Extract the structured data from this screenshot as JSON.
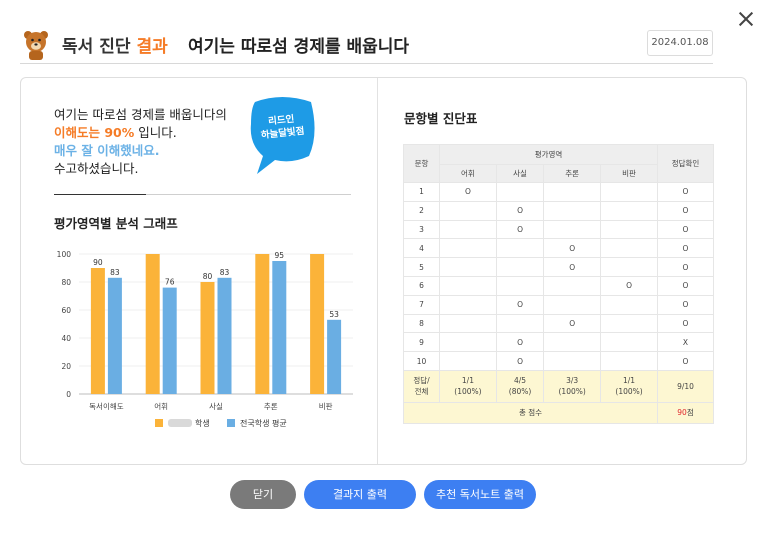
{
  "header": {
    "title": "독서 진단",
    "title_accent": "결과",
    "book_title": "여기는 따로섬 경제를 배웁니다",
    "date": "2024.01.08"
  },
  "message": {
    "line1": "여기는 따로섬 경제를 배웁니다의",
    "line2_highlight": "이해도는 90%",
    "line2_rest": " 입니다.",
    "line3": "매우 잘 이해했네요.",
    "line4": "수고하셨습니다."
  },
  "badge": {
    "line1": "리드인",
    "line2": "하늘달빛점"
  },
  "chart_section_title": "평가영역별 분석 그래프",
  "chart_data": {
    "type": "bar",
    "categories": [
      "독서이해도",
      "어휘",
      "사실",
      "추론",
      "비판"
    ],
    "series": [
      {
        "name": "학생",
        "values": [
          90,
          100,
          80,
          100,
          100
        ],
        "labels": [
          "90",
          "",
          "80",
          "",
          ""
        ],
        "color": "#fbb339"
      },
      {
        "name": "전국학생 평균",
        "values": [
          83,
          76,
          83,
          95,
          53
        ],
        "labels": [
          "83",
          "76",
          "83",
          "95",
          "53"
        ],
        "color": "#6aaee3"
      }
    ],
    "ylim": [
      0,
      100
    ],
    "yticks": [
      "0",
      "20",
      "40",
      "60",
      "80",
      "100"
    ],
    "legend_position": "bottom"
  },
  "table_section_title": "문항별 진단표",
  "table": {
    "col_question": "문항",
    "col_group": "평가영역",
    "col_check": "정답확인",
    "areas": [
      "어휘",
      "사실",
      "추론",
      "비판"
    ],
    "rows": [
      {
        "no": "1",
        "cells": [
          "O",
          "",
          "",
          ""
        ],
        "check": "O"
      },
      {
        "no": "2",
        "cells": [
          "",
          "O",
          "",
          ""
        ],
        "check": "O"
      },
      {
        "no": "3",
        "cells": [
          "",
          "O",
          "",
          ""
        ],
        "check": "O"
      },
      {
        "no": "4",
        "cells": [
          "",
          "",
          "O",
          ""
        ],
        "check": "O"
      },
      {
        "no": "5",
        "cells": [
          "",
          "",
          "O",
          ""
        ],
        "check": "O"
      },
      {
        "no": "6",
        "cells": [
          "",
          "",
          "",
          "O"
        ],
        "check": "O"
      },
      {
        "no": "7",
        "cells": [
          "",
          "O",
          "",
          ""
        ],
        "check": "O"
      },
      {
        "no": "8",
        "cells": [
          "",
          "",
          "O",
          ""
        ],
        "check": "O"
      },
      {
        "no": "9",
        "cells": [
          "",
          "O",
          "",
          ""
        ],
        "check": "X"
      },
      {
        "no": "10",
        "cells": [
          "",
          "O",
          "",
          ""
        ],
        "check": "O"
      }
    ],
    "summary_label": "정답/\n전체",
    "summary": [
      {
        "frac": "1/1",
        "pct": "(100%)"
      },
      {
        "frac": "4/5",
        "pct": "(80%)"
      },
      {
        "frac": "3/3",
        "pct": "(100%)"
      },
      {
        "frac": "1/1",
        "pct": "(100%)"
      }
    ],
    "summary_check": "9/10",
    "total_label": "총 점수",
    "total_score": "90",
    "total_unit": "점"
  },
  "buttons": {
    "close": "닫기",
    "print": "결과지 출력",
    "recommend": "추천 독서노트 출력"
  },
  "colors": {
    "accent": "#f57c27",
    "understanding": "#6cb2e6",
    "button_primary": "#3d7ff2",
    "button_secondary": "#7a7a7a",
    "student_bar": "#fbb339",
    "average_bar": "#6aaee3",
    "badge": "#1e9be6"
  },
  "icons": {
    "close": "close-icon",
    "mascot": "bear-mascot-icon"
  }
}
